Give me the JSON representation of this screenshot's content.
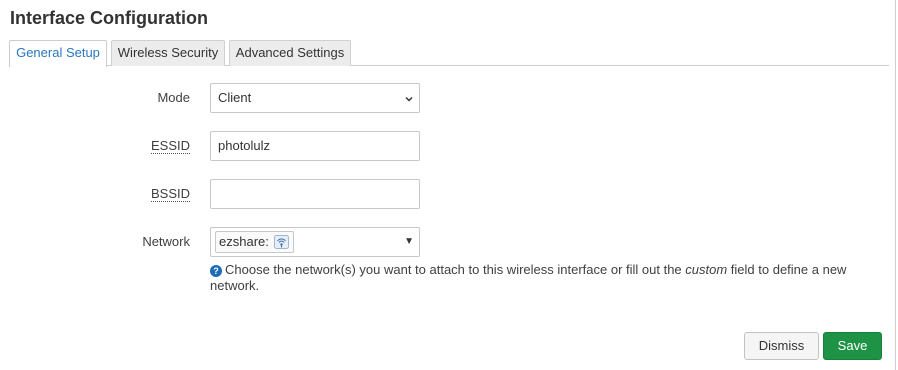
{
  "dialog": {
    "title": "Interface Configuration"
  },
  "tabs": [
    {
      "label": "General Setup",
      "active": true
    },
    {
      "label": "Wireless Security",
      "active": false
    },
    {
      "label": "Advanced Settings",
      "active": false
    }
  ],
  "form": {
    "mode": {
      "label": "Mode",
      "value": "Client"
    },
    "essid": {
      "label": "ESSID",
      "value": "photolulz"
    },
    "bssid": {
      "label": "BSSID",
      "value": ""
    },
    "network": {
      "label": "Network",
      "chip": "ezshare:",
      "chip_icon": "wifi-network-icon",
      "help_before": "Choose the network(s) you want to attach to this wireless interface or fill out the ",
      "help_em": "custom",
      "help_after": " field to define a new network."
    }
  },
  "buttons": {
    "dismiss": "Dismiss",
    "save": "Save"
  },
  "colors": {
    "accent": "#2a77c0",
    "save": "#1e9346",
    "help_icon": "#1f6bb8"
  }
}
